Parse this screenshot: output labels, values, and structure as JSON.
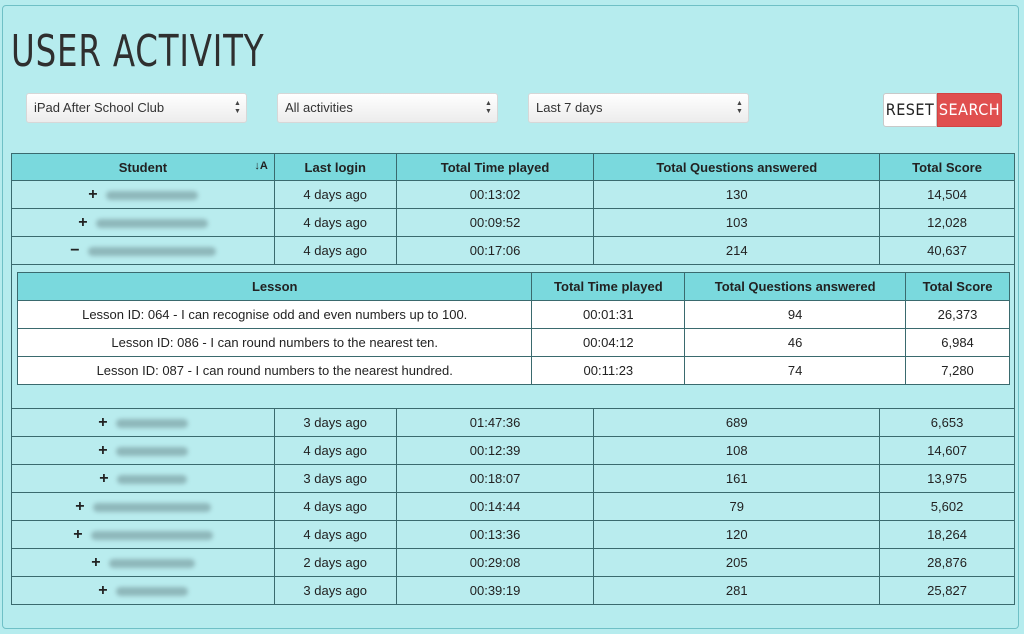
{
  "page_title": "USER ACTIVITY",
  "filters": {
    "group": "iPad After School Club",
    "activity": "All activities",
    "period": "Last 7 days"
  },
  "buttons": {
    "reset": "RESET",
    "search": "SEARCH"
  },
  "main_table": {
    "headers": [
      "Student",
      "Last login",
      "Total Time played",
      "Total Questions answered",
      "Total Score"
    ],
    "rows": [
      {
        "toggle": "+",
        "last_login": "4 days ago",
        "time": "00:13:02",
        "questions": "130",
        "score": "14,504"
      },
      {
        "toggle": "+",
        "last_login": "4 days ago",
        "time": "00:09:52",
        "questions": "103",
        "score": "12,028"
      },
      {
        "toggle": "−",
        "last_login": "4 days ago",
        "time": "00:17:06",
        "questions": "214",
        "score": "40,637"
      }
    ]
  },
  "lesson_table": {
    "headers": [
      "Lesson",
      "Total Time played",
      "Total Questions answered",
      "Total Score"
    ],
    "rows": [
      {
        "lesson": "Lesson ID: 064 - I can recognise odd and even numbers up to 100.",
        "time": "00:01:31",
        "questions": "94",
        "score": "26,373"
      },
      {
        "lesson": "Lesson ID: 086 - I can round numbers to the nearest ten.",
        "time": "00:04:12",
        "questions": "46",
        "score": "6,984"
      },
      {
        "lesson": "Lesson ID: 087 - I can round numbers to the nearest hundred.",
        "time": "00:11:23",
        "questions": "74",
        "score": "7,280"
      }
    ]
  },
  "bottom_rows": [
    {
      "toggle": "+",
      "last_login": "3 days ago",
      "time": "01:47:36",
      "questions": "689",
      "score": "6,653"
    },
    {
      "toggle": "+",
      "last_login": "4 days ago",
      "time": "00:12:39",
      "questions": "108",
      "score": "14,607"
    },
    {
      "toggle": "+",
      "last_login": "3 days ago",
      "time": "00:18:07",
      "questions": "161",
      "score": "13,975"
    },
    {
      "toggle": "+",
      "last_login": "4 days ago",
      "time": "00:14:44",
      "questions": "79",
      "score": "5,602"
    },
    {
      "toggle": "+",
      "last_login": "4 days ago",
      "time": "00:13:36",
      "questions": "120",
      "score": "18,264"
    },
    {
      "toggle": "+",
      "last_login": "2 days ago",
      "time": "00:29:08",
      "questions": "205",
      "score": "28,876"
    },
    {
      "toggle": "+",
      "last_login": "3 days ago",
      "time": "00:39:19",
      "questions": "281",
      "score": "25,827"
    }
  ]
}
